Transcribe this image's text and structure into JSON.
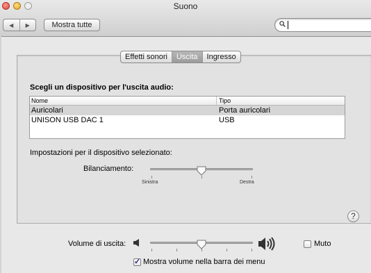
{
  "window": {
    "title": "Suono"
  },
  "toolbar": {
    "back_glyph": "◀",
    "forward_glyph": "▶",
    "show_all_label": "Mostra tutte",
    "search_value": ""
  },
  "tabs": [
    {
      "label": "Effetti sonori",
      "active": false
    },
    {
      "label": "Uscita",
      "active": true
    },
    {
      "label": "Ingresso",
      "active": false
    }
  ],
  "output": {
    "section_title": "Scegli un dispositivo per l'uscita audio:",
    "columns": {
      "name": "Nome",
      "type": "Tipo"
    },
    "rows": [
      {
        "name": "Auricolari",
        "type": "Porta auricolari",
        "selected": true
      },
      {
        "name": "UNISON USB DAC 1",
        "type": "USB",
        "selected": false
      }
    ],
    "settings_label": "Impostazioni per il dispositivo selezionato:",
    "balance": {
      "label": "Bilanciamento:",
      "left_label": "Sinistra",
      "right_label": "Destra",
      "value": 0.5
    }
  },
  "help_glyph": "?",
  "volume": {
    "label": "Volume di uscita:",
    "value": 0.5,
    "mute_label": "Muto",
    "mute_checked": false,
    "menu_bar_label": "Mostra volume nella barra dei menu",
    "menu_bar_checked": true
  },
  "colors": {
    "selected_tab": "#a8a8a8",
    "selected_row": "#d5d5d5",
    "close": "#e0443a",
    "minimize": "#e6a21b"
  }
}
